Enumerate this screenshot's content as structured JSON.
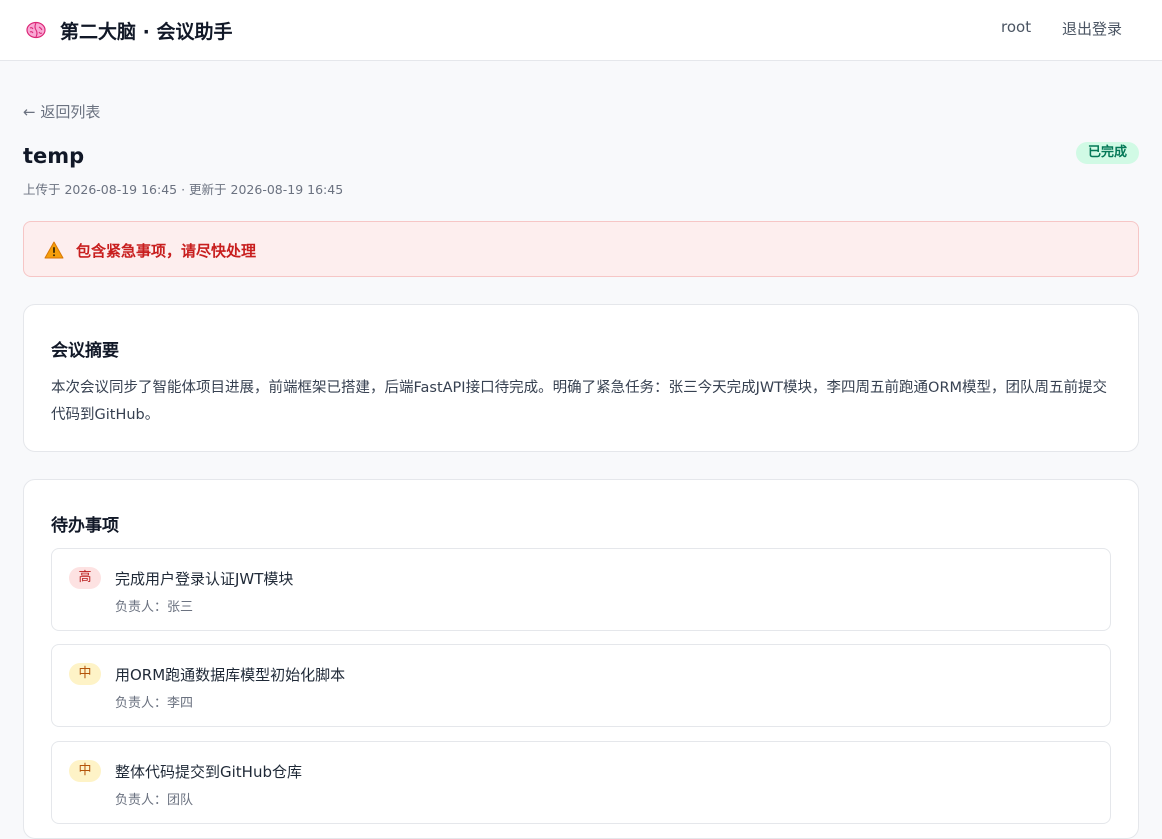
{
  "header": {
    "title": "第二大脑 · 会议助手",
    "brand_icon": "brain-icon",
    "user": "root",
    "logout": "退出登录"
  },
  "nav": {
    "back": "← 返回列表"
  },
  "meeting": {
    "title": "temp",
    "meta": "上传于 2026-08-19 16:45 · 更新于 2026-08-19 16:45",
    "status": "已完成",
    "status_color": "#047857"
  },
  "alert": {
    "icon": "warning-icon",
    "text": "包含紧急事项，请尽快处理",
    "color": "#c81e1e"
  },
  "summary": {
    "heading": "会议摘要",
    "text": "本次会议同步了智能体项目进展，前端框架已搭建，后端FastAPI接口待完成。明确了紧急任务：张三今天完成JWT模块，李四周五前跑通ORM模型，团队周五前提交代码到GitHub。"
  },
  "todos": {
    "heading": "待办事项",
    "items": [
      {
        "priority": "高",
        "title": "完成用户登录认证JWT模块",
        "owner": "负责人：张三"
      },
      {
        "priority": "中",
        "title": "用ORM跑通数据库模型初始化脚本",
        "owner": "负责人：李四"
      },
      {
        "priority": "中",
        "title": "整体代码提交到GitHub仓库",
        "owner": "负责人：团队"
      }
    ]
  }
}
